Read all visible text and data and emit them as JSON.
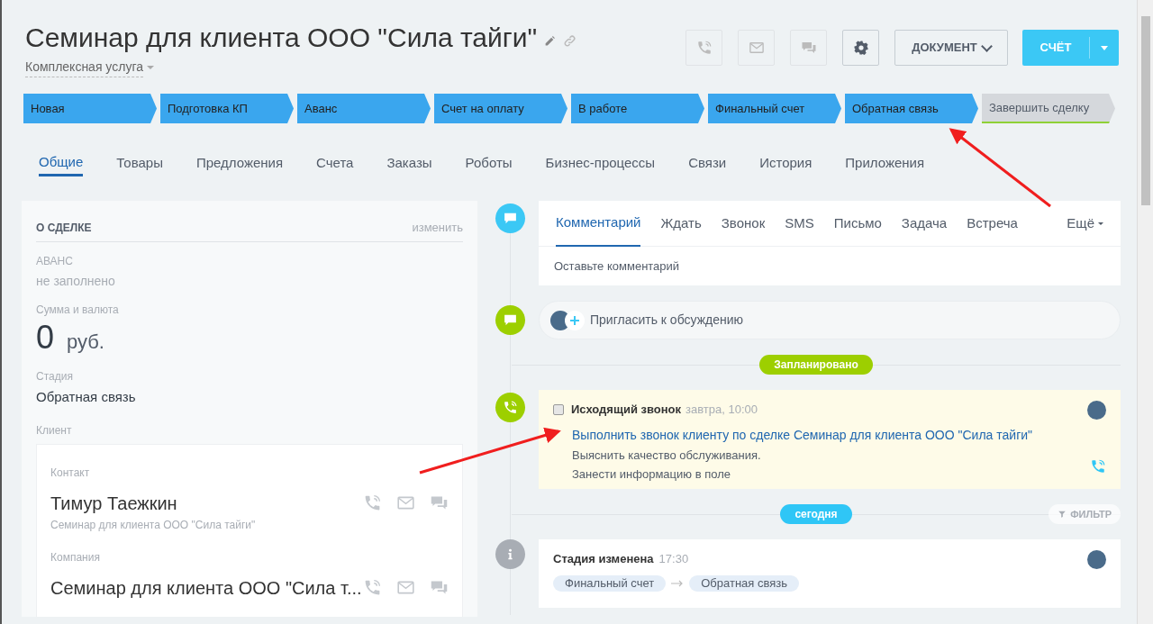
{
  "header": {
    "title": "Семинар для клиента ООО \"Сила тайги\"",
    "subtitle": "Комплексная услуга",
    "document_button": "ДОКУМЕНТ",
    "invoice_button": "СЧЁТ"
  },
  "stages": [
    {
      "label": "Новая",
      "done": true
    },
    {
      "label": "Подготовка КП",
      "done": true
    },
    {
      "label": "Аванс",
      "done": true
    },
    {
      "label": "Счет на оплату",
      "done": true
    },
    {
      "label": "В работе",
      "done": true
    },
    {
      "label": "Финальный счет",
      "done": true
    },
    {
      "label": "Обратная связь",
      "done": true
    },
    {
      "label": "Завершить сделку",
      "done": false
    }
  ],
  "tabs": [
    {
      "label": "Общие",
      "selected": true
    },
    {
      "label": "Товары",
      "selected": false
    },
    {
      "label": "Предложения",
      "selected": false
    },
    {
      "label": "Счета",
      "selected": false
    },
    {
      "label": "Заказы",
      "selected": false
    },
    {
      "label": "Роботы",
      "selected": false
    },
    {
      "label": "Бизнес-процессы",
      "selected": false
    },
    {
      "label": "Связи",
      "selected": false
    },
    {
      "label": "История",
      "selected": false
    },
    {
      "label": "Приложения",
      "selected": false
    }
  ],
  "deal_card": {
    "title": "О СДЕЛКЕ",
    "edit_link": "изменить",
    "fields": [
      {
        "kind": "empty",
        "label": "АВАНС",
        "value": "не заполнено"
      },
      {
        "kind": "amount",
        "label": "Сумма и валюта",
        "value": "0",
        "currency": "руб."
      },
      {
        "kind": "text",
        "label": "Стадия",
        "value": "Обратная связь"
      }
    ],
    "client": {
      "label": "Клиент",
      "entries": [
        {
          "label": "Контакт",
          "name": "Тимур Таежкин",
          "description": "Семинар для клиента ООО \"Сила тайги\""
        },
        {
          "label": "Компания",
          "name": "Семинар для клиента ООО \"Сила т..."
        }
      ]
    }
  },
  "timeline": {
    "composer": {
      "tabs": [
        {
          "label": "Комментарий",
          "selected": true
        },
        {
          "label": "Ждать",
          "selected": false
        },
        {
          "label": "Звонок",
          "selected": false
        },
        {
          "label": "SMS",
          "selected": false
        },
        {
          "label": "Письмо",
          "selected": false
        },
        {
          "label": "Задача",
          "selected": false
        },
        {
          "label": "Встреча",
          "selected": false
        }
      ],
      "more": "Ещё",
      "placeholder": "Оставьте комментарий"
    },
    "invite": "Пригласить к обсуждению",
    "planned_label": "Запланировано",
    "planned": [
      {
        "checked": false,
        "title": "Исходящий звонок",
        "time": "завтра, 10:00",
        "link": "Выполнить звонок клиенту по сделке Семинар для клиента ООО \"Сила тайги\"",
        "description": [
          "Выяснить качество обслуживания.",
          "Занести информацию в поле"
        ]
      }
    ],
    "today_label": "сегодня",
    "filter": "ФИЛЬТР",
    "history": [
      {
        "title": "Стадия изменена",
        "time": "17:30",
        "from": "Финальный счет",
        "to": "Обратная связь"
      }
    ]
  }
}
